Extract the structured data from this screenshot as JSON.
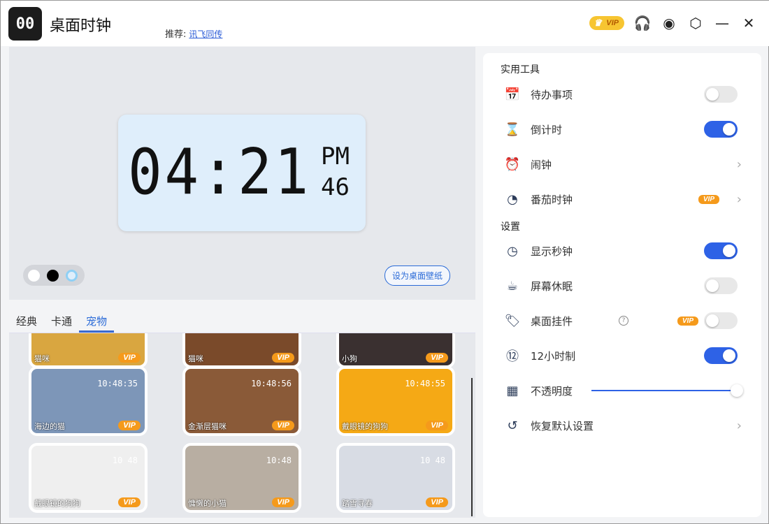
{
  "app": {
    "logo": "00",
    "title": "桌面时钟",
    "recommend_label": "推荐:",
    "recommend_link": "讯飞同传",
    "vip": "VIP"
  },
  "clock": {
    "time": "04:21",
    "ampm": "PM",
    "seconds": "46",
    "set_wallpaper": "设为桌面壁纸",
    "colors": [
      "#ffffff",
      "#000000",
      "#dfeefb"
    ]
  },
  "tabs": [
    "经典",
    "卡通",
    "宠物"
  ],
  "cards": [
    {
      "name": "猫咪",
      "vip": "VIP",
      "color": "#d9a640"
    },
    {
      "name": "猫咪",
      "vip": "VIP",
      "color": "#7a4a2a"
    },
    {
      "name": "小狗",
      "vip": "VIP",
      "color": "#3a3030"
    },
    {
      "name": "海边的猫",
      "vip": "VIP",
      "clock": "10:48:35",
      "color": "#7d96b8"
    },
    {
      "name": "金渐层猫咪",
      "vip": "VIP",
      "clock": "10:48:56",
      "color": "#8a5a38"
    },
    {
      "name": "戴眼镜的狗狗",
      "vip": "VIP",
      "clock": "10:48:55",
      "color": "#f5a915"
    },
    {
      "name": "戴眼镜的狗狗",
      "vip": "VIP",
      "clock": "10 48",
      "color": "#efefef"
    },
    {
      "name": "慵懒的小猫",
      "vip": "VIP",
      "clock": "10:48",
      "color": "#b8aea2"
    },
    {
      "name": "踏雪寻春",
      "vip": "VIP",
      "clock": "10 48",
      "color": "#d8dce4"
    }
  ],
  "tools": {
    "title": "实用工具",
    "items": [
      {
        "label": "待办事项",
        "icon": "calendar-check-icon",
        "glyph": "📅",
        "toggle": false
      },
      {
        "label": "倒计时",
        "icon": "hourglass-icon",
        "glyph": "⌛",
        "toggle": true
      },
      {
        "label": "闹钟",
        "icon": "alarm-clock-icon",
        "glyph": "⏰",
        "chevron": true
      },
      {
        "label": "番茄时钟",
        "icon": "tomato-icon",
        "glyph": "◔",
        "vip": "VIP",
        "chevron": true
      }
    ]
  },
  "settings": {
    "title": "设置",
    "items": [
      {
        "label": "显示秒钟",
        "glyph": "◷",
        "toggle": true
      },
      {
        "label": "屏幕休眠",
        "glyph": "☕",
        "toggle": false
      },
      {
        "label": "桌面挂件",
        "glyph": "🏷",
        "help": "?",
        "vip": "VIP",
        "toggle": false
      },
      {
        "label": "12小时制",
        "glyph": "⑫",
        "toggle": true
      },
      {
        "label": "不透明度",
        "glyph": "▦",
        "opacity": 1.0
      },
      {
        "label": "恢复默认设置",
        "glyph": "↺",
        "chevron": true
      }
    ]
  }
}
